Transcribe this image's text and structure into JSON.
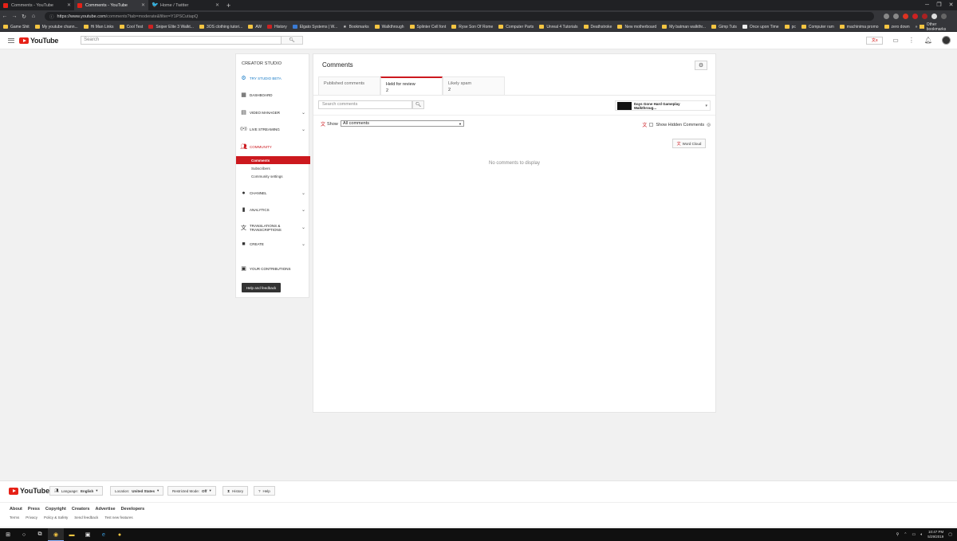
{
  "browser": {
    "tabs": [
      {
        "title": "Comments - YouTube",
        "icon": "youtube-favicon",
        "active": false
      },
      {
        "title": "Comments - YouTube",
        "icon": "youtube-favicon",
        "active": true
      },
      {
        "title": "Home / Twitter",
        "icon": "twitter-favicon",
        "active": false
      }
    ],
    "url_host": "https://www.youtube.com",
    "url_path": "/comments?tab=moderate&filter=Y1PSCutiapQ",
    "bookmarks": [
      "Game Shit",
      "My youtube chann...",
      "Hi Man Links",
      "Cool Test",
      "Sniper Elite 3 Walkt...",
      "3OS clothing tutori...",
      "AW",
      "History",
      "Elgato Systems | W...",
      "Bookmarks",
      "Walkthrough",
      "Splinter Cell font",
      "Ryse Son Of Rome",
      "Computer Parts",
      "Unreal 4 Tutorials",
      "Deathstroke",
      "New motherboard",
      "My batman walkthr...",
      "Gimp Tuts",
      "Once upon Time",
      "pc",
      "Computer ram",
      "machinima promo",
      "zero down"
    ],
    "other_bookmarks": "Other bookmarks"
  },
  "header": {
    "logo_text": "YouTube",
    "search_placeholder": "Search"
  },
  "sidebar": {
    "title": "CREATOR STUDIO",
    "studio_beta": "TRY STUDIO BETA",
    "dashboard": "DASHBOARD",
    "video_manager": "VIDEO MANAGER",
    "live_streaming": "LIVE STREAMING",
    "community": "COMMUNITY",
    "sub_comments": "Comments",
    "sub_subscribers": "Subscribers",
    "sub_community_settings": "Community settings",
    "channel": "CHANNEL",
    "analytics": "ANALYTICS",
    "translations_1": "TRANSLATIONS &",
    "translations_2": "TRANSCRIPTIONS",
    "create": "CREATE",
    "contributions": "YOUR CONTRIBUTIONS",
    "help": "Help and feedback"
  },
  "main": {
    "title": "Comments",
    "tabs": [
      {
        "label": "Published comments",
        "count": ""
      },
      {
        "label": "Held for review",
        "count": "2"
      },
      {
        "label": "Likely spam",
        "count": "2"
      }
    ],
    "search_placeholder": "Search comments",
    "video_title": "Days Gone Hard Gameplay Walkthroug...",
    "show_label": "Show",
    "show_value": "All comments",
    "hidden_label": "Show Hidden Comments",
    "word_cloud": "Word Cloud",
    "empty_text": "No comments to display"
  },
  "footer": {
    "logo_text": "YouTube",
    "language_label": "Language:",
    "language_value": "English",
    "location_label": "Location:",
    "location_value": "United States",
    "restricted_label": "Restricted Mode:",
    "restricted_value": "Off",
    "history": "History",
    "help": "Help",
    "links1": [
      "About",
      "Press",
      "Copyright",
      "Creators",
      "Advertise",
      "Developers"
    ],
    "links2": [
      "Terms",
      "Privacy",
      "Policy & Safety",
      "Send feedback",
      "Test new features"
    ]
  },
  "taskbar": {
    "time": "10:47 PM",
    "date": "5/29/2019"
  },
  "colors": {
    "accent_red": "#cc181e",
    "studio_blue": "#167ac6"
  }
}
